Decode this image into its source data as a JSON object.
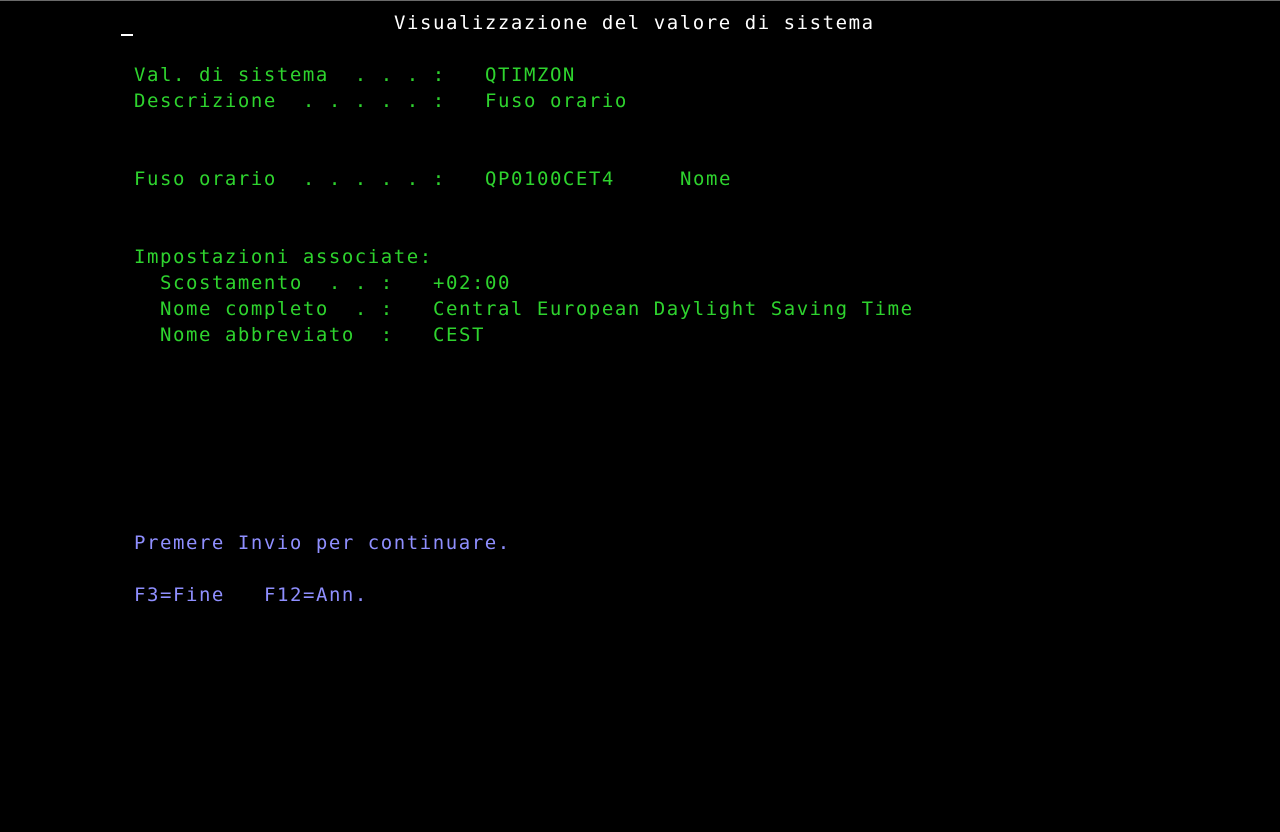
{
  "screen": {
    "title": "Visualizzazione del valore di sistema"
  },
  "sysval": {
    "label": "Val. di sistema  . . . :",
    "value": "QTIMZON"
  },
  "description": {
    "label": "Descrizione  . . . . . :",
    "value": "Fuso orario"
  },
  "timezone": {
    "label": "Fuso orario  . . . . . :",
    "value": "QP0100CET4",
    "hint": "Nome"
  },
  "associated": {
    "heading": "Impostazioni associate:",
    "offset": {
      "label": "Scostamento  . . :",
      "value": "+02:00"
    },
    "full_name": {
      "label": "Nome completo  . :",
      "value": "Central European Daylight Saving Time"
    },
    "short_name": {
      "label": "Nome abbreviato  :",
      "value": "CEST"
    }
  },
  "instruction": "Premere Invio per continuare.",
  "function_keys": {
    "f3": "F3=Fine",
    "f12": "F12=Ann."
  },
  "colors": {
    "background": "#000000",
    "field_text": "#2ed32e",
    "title_text": "#ffffff",
    "help_text": "#8f8fff"
  }
}
